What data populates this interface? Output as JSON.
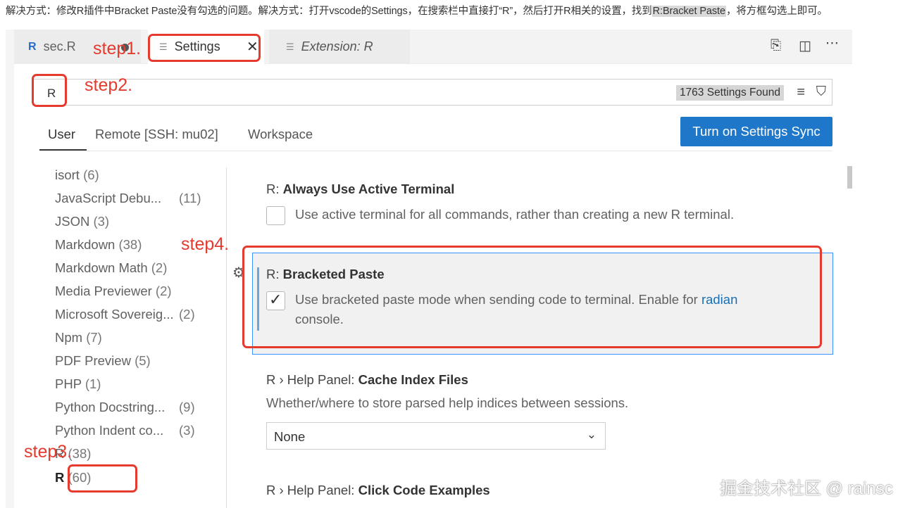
{
  "caption": {
    "text": "解决方式：修改R插件中Bracket Paste没有勾选的问题。解决方式：打开vscode的Settings，在搜索栏中直接打“R”，然后打开R相关的设置，找到",
    "highlight": "R:Bracket Paste",
    "suffix": "，将方框勾选上即可。"
  },
  "tabs": {
    "sec": {
      "icon": "r-logo-icon",
      "label": "sec.R"
    },
    "settings": {
      "label": "Settings",
      "close": "✕"
    },
    "extension": {
      "label": "Extension: R"
    }
  },
  "search": {
    "value": "R",
    "results": "1763 Settings Found"
  },
  "scopes": {
    "user": "User",
    "remote": "Remote [SSH: mu02]",
    "workspace": "Workspace"
  },
  "sync_button": "Turn on Settings Sync",
  "toc": [
    {
      "label": "isort",
      "count": "(6)"
    },
    {
      "label": "JavaScript Debu...",
      "count": "(11)"
    },
    {
      "label": "JSON",
      "count": "(3)"
    },
    {
      "label": "Markdown",
      "count": "(38)"
    },
    {
      "label": "Markdown Math",
      "count": "(2)"
    },
    {
      "label": "Media Previewer",
      "count": "(2)"
    },
    {
      "label": "Microsoft Sovereig...",
      "count": "(2)"
    },
    {
      "label": "Npm",
      "count": "(7)"
    },
    {
      "label": "PDF Preview",
      "count": "(5)"
    },
    {
      "label": "PHP",
      "count": "(1)"
    },
    {
      "label": "Python Docstring...",
      "count": "(9)"
    },
    {
      "label": "Python Indent co...",
      "count": "(3)"
    },
    {
      "label": "R",
      "count": "(38)"
    },
    {
      "label": "R",
      "count": "(60)"
    }
  ],
  "settings": {
    "terminal": {
      "prefix": "R: ",
      "name": "Always Use Active Terminal",
      "desc": "Use active terminal for all commands, rather than creating a new R terminal.",
      "checked": false
    },
    "bracket": {
      "prefix": "R: ",
      "name": "Bracketed Paste",
      "desc": "Use bracketed paste mode when sending code to terminal. Enable for ",
      "link": "radian",
      "desc2": "console.",
      "checked": true
    },
    "help_cache": {
      "prefix": "R › Help Panel: ",
      "name": "Cache Index Files",
      "desc": "Whether/where to store parsed help indices between sessions.",
      "value": "None"
    },
    "next": {
      "prefix": "R › Help Panel: ",
      "name": "Click Code Examples"
    }
  },
  "annotations": {
    "step1": "step1.",
    "step2": "step2.",
    "step3": "step3.",
    "step4": "step4."
  },
  "watermark": "掘金技术社区 @ rainsc",
  "colors": {
    "annotation": "#e53a2e",
    "sync_button": "#1f77c9",
    "focus_border": "#3794ff",
    "link": "#1a6fb5"
  }
}
